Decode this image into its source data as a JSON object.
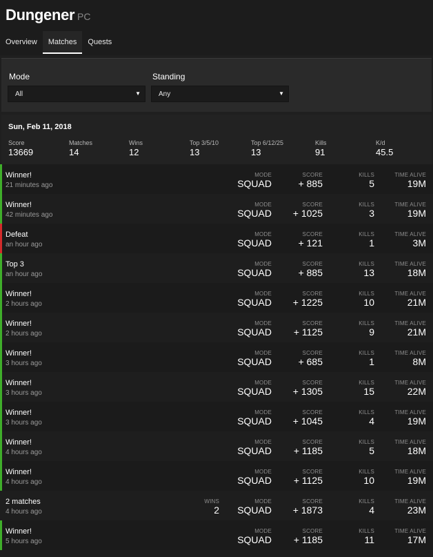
{
  "player": {
    "name": "Dungener",
    "platform": "PC"
  },
  "tabs": [
    {
      "label": "Overview",
      "active": false
    },
    {
      "label": "Matches",
      "active": true
    },
    {
      "label": "Quests",
      "active": false
    }
  ],
  "filters": {
    "mode_label": "Mode",
    "mode_value": "All",
    "standing_label": "Standing",
    "standing_value": "Any"
  },
  "summary": {
    "date": "Sun, Feb 11, 2018",
    "stats": [
      {
        "label": "Score",
        "value": "13669"
      },
      {
        "label": "Matches",
        "value": "14"
      },
      {
        "label": "Wins",
        "value": "12"
      },
      {
        "label": "Top 3/5/10",
        "value": "13"
      },
      {
        "label": "Top 6/12/25",
        "value": "13"
      },
      {
        "label": "Kills",
        "value": "91"
      },
      {
        "label": "K/d",
        "value": "45.5"
      }
    ]
  },
  "column_labels": {
    "wins": "WINS",
    "mode": "MODE",
    "score": "SCORE",
    "kills": "KILLS",
    "time": "TIME ALIVE"
  },
  "matches": [
    {
      "result": "Winner!",
      "time": "21 minutes ago",
      "mode": "SQUAD",
      "score": "+ 885",
      "kills": "5",
      "time_alive": "19M",
      "status": "win"
    },
    {
      "result": "Winner!",
      "time": "42 minutes ago",
      "mode": "SQUAD",
      "score": "+ 1025",
      "kills": "3",
      "time_alive": "19M",
      "status": "win"
    },
    {
      "result": "Defeat",
      "time": "an hour ago",
      "mode": "SQUAD",
      "score": "+ 121",
      "kills": "1",
      "time_alive": "3M",
      "status": "defeat"
    },
    {
      "result": "Top 3",
      "time": "an hour ago",
      "mode": "SQUAD",
      "score": "+ 885",
      "kills": "13",
      "time_alive": "18M",
      "status": "win"
    },
    {
      "result": "Winner!",
      "time": "2 hours ago",
      "mode": "SQUAD",
      "score": "+ 1225",
      "kills": "10",
      "time_alive": "21M",
      "status": "win"
    },
    {
      "result": "Winner!",
      "time": "2 hours ago",
      "mode": "SQUAD",
      "score": "+ 1125",
      "kills": "9",
      "time_alive": "21M",
      "status": "win"
    },
    {
      "result": "Winner!",
      "time": "3 hours ago",
      "mode": "SQUAD",
      "score": "+ 685",
      "kills": "1",
      "time_alive": "8M",
      "status": "win"
    },
    {
      "result": "Winner!",
      "time": "3 hours ago",
      "mode": "SQUAD",
      "score": "+ 1305",
      "kills": "15",
      "time_alive": "22M",
      "status": "win"
    },
    {
      "result": "Winner!",
      "time": "3 hours ago",
      "mode": "SQUAD",
      "score": "+ 1045",
      "kills": "4",
      "time_alive": "19M",
      "status": "win"
    },
    {
      "result": "Winner!",
      "time": "4 hours ago",
      "mode": "SQUAD",
      "score": "+ 1185",
      "kills": "5",
      "time_alive": "18M",
      "status": "win"
    },
    {
      "result": "Winner!",
      "time": "4 hours ago",
      "mode": "SQUAD",
      "score": "+ 1125",
      "kills": "10",
      "time_alive": "19M",
      "status": "win"
    },
    {
      "result": "2 matches",
      "time": "4 hours ago",
      "wins": "2",
      "mode": "SQUAD",
      "score": "+ 1873",
      "kills": "4",
      "time_alive": "23M",
      "status": "multi"
    },
    {
      "result": "Winner!",
      "time": "5 hours ago",
      "mode": "SQUAD",
      "score": "+ 1185",
      "kills": "11",
      "time_alive": "17M",
      "status": "win"
    }
  ],
  "colors": {
    "win": "#3fae2a",
    "defeat": "#d32b2b",
    "background": "#1f1f1f"
  }
}
